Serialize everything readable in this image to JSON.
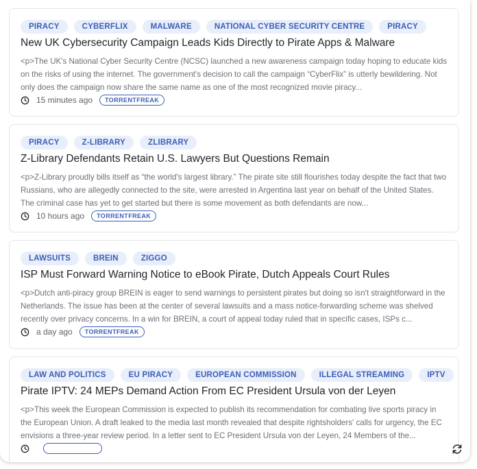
{
  "articles": [
    {
      "tags": [
        "PIRACY",
        "CYBERFLIX",
        "MALWARE",
        "NATIONAL CYBER SECURITY CENTRE",
        "PIRACY"
      ],
      "title": "New UK Cybersecurity Campaign Leads Kids Directly to Pirate Apps & Malware",
      "summary": "<p>The UK's National Cyber Security Centre (NCSC) launched a new awareness campaign today hoping to educate kids on the risks of using the internet. The government's decision to call the campaign “CyberFlix” is utterly bewildering. Not only does the campaign now share the same name as one of the most recognized movie piracy...",
      "time": "15 minutes ago",
      "source": "TORRENTFREAK"
    },
    {
      "tags": [
        "PIRACY",
        "Z-LIBRARY",
        "ZLIBRARY"
      ],
      "title": "Z-Library Defendants Retain U.S. Lawyers But Questions Remain",
      "summary": "<p>Z-Library proudly bills itself as “the world's largest library.” The pirate site still flourishes today despite the fact that two Russians, who are allegedly connected to the site, were arrested in Argentina last year on behalf of the United States. The criminal case has yet to get started but there is some movement as both defendants are now...",
      "time": "10 hours ago",
      "source": "TORRENTFREAK"
    },
    {
      "tags": [
        "LAWSUITS",
        "BREIN",
        "ZIGGO"
      ],
      "title": "ISP Must Forward Warning Notice to eBook Pirate, Dutch Appeals Court Rules",
      "summary": "<p>Dutch anti-piracy group BREIN is eager to send warnings to persistent pirates but doing so isn't straightforward in the Netherlands. The issue has been at the center of several lawsuits and a mass notice-forwarding scheme was shelved recently over privacy concerns. In a win for BREIN, a court of appeal today ruled that in specific cases, ISPs c...",
      "time": "a day ago",
      "source": "TORRENTFREAK"
    },
    {
      "tags": [
        "LAW AND POLITICS",
        "EU PIRACY",
        "EUROPEAN COMMISSION",
        "ILLEGAL STREAMING",
        "IPTV"
      ],
      "title": "Pirate IPTV: 24 MEPs Demand Action From EC President Ursula von der Leyen",
      "summary": "<p>This week the European Commission is expected to publish its recommendation for combating live sports piracy in the European Union. A draft leaked to the media last month revealed that despite rightsholders' calls for urgency, the EC envisions a three-year review period. In a letter sent to EC President Ursula von der Leyen, 24 Members of the...",
      "time": "",
      "source": ""
    }
  ],
  "icons": {
    "time": "clock-icon",
    "refresh": "refresh-icon"
  },
  "colors": {
    "tag_bg": "#e8effa",
    "tag_text": "#3c5db8",
    "title": "#1f2328",
    "summary": "#6b6f76"
  }
}
